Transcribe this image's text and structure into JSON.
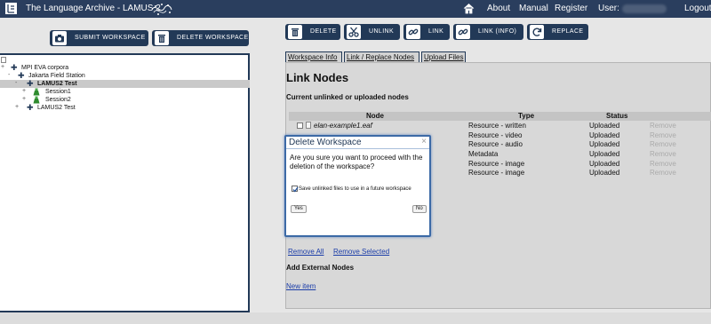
{
  "header": {
    "title": "The Language Archive - LAMUS 2",
    "nav": [
      "About",
      "Manual",
      "Register"
    ],
    "user_label": "User:",
    "logout": "Logout"
  },
  "toolbar_left": {
    "submit": "SUBMIT WORKSPACE",
    "delete": "DELETE WORKSPACE"
  },
  "toolbar_right": {
    "delete": "DELETE",
    "unlink": "UNLINK",
    "link": "LINK",
    "link_info": "LINK (INFO)",
    "replace": "REPLACE"
  },
  "tree": {
    "items": [
      {
        "label": "MPI EVA corpora",
        "expand": "+"
      },
      {
        "label": "Jakarta Field Station",
        "expand": "-"
      },
      {
        "label": "LAMUS2 Test",
        "expand": "-"
      },
      {
        "label": "Session1",
        "expand": "+"
      },
      {
        "label": "Session2",
        "expand": "+"
      },
      {
        "label": "LAMUS2 Test",
        "expand": "+"
      }
    ]
  },
  "tabs": [
    "Workspace Info",
    "Link / Replace Nodes",
    "Upload Files"
  ],
  "main": {
    "heading": "Link Nodes",
    "subheading": "Current unlinked or uploaded nodes",
    "columns": [
      "Node",
      "Type",
      "Status"
    ],
    "rows": [
      {
        "node": "elan-example1.eaf",
        "type": "Resource - written",
        "status": "Uploaded",
        "action": "Remove"
      },
      {
        "node": "",
        "type": "Resource - video",
        "status": "Uploaded",
        "action": "Remove"
      },
      {
        "node": "",
        "type": "Resource - audio",
        "status": "Uploaded",
        "action": "Remove"
      },
      {
        "node": "",
        "type": "Metadata",
        "status": "Uploaded",
        "action": "Remove"
      },
      {
        "node": "",
        "type": "Resource - image",
        "status": "Uploaded",
        "action": "Remove"
      },
      {
        "node": "",
        "type": "Resource - image",
        "status": "Uploaded",
        "action": "Remove"
      }
    ],
    "remove_all": "Remove All",
    "remove_selected": "Remove Selected",
    "add_external": "Add External Nodes",
    "new_item": "New item"
  },
  "dialog": {
    "title": "Delete Workspace",
    "close": "×",
    "message": "Are you sure you want to proceed with the deletion of the workspace?",
    "checkbox_label": "Save unlinked files to use in a future workspace",
    "yes": "Yes",
    "no": "No"
  },
  "colors": {
    "navy": "#223957",
    "topbar": "#2a3e5e",
    "link": "#1a3ca8",
    "dialog_border": "#3c6aa6"
  }
}
